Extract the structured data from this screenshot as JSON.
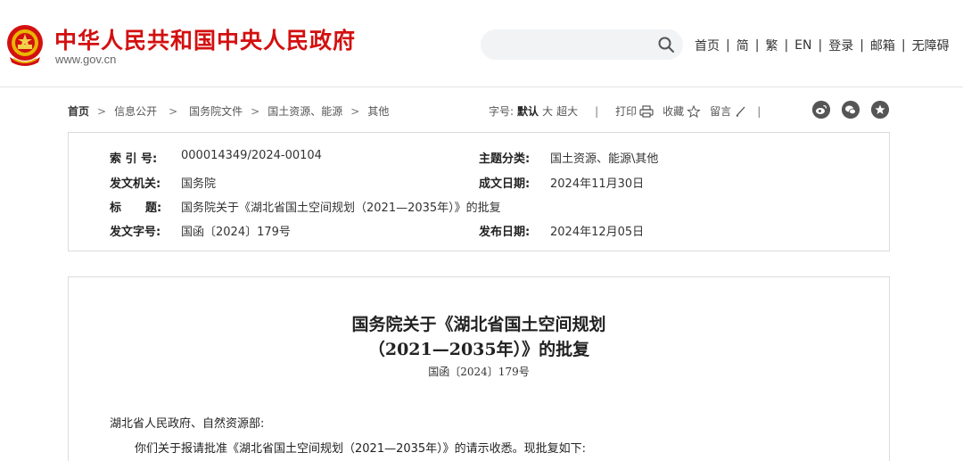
{
  "header": {
    "site_title": "中华人民共和国中央人民政府",
    "site_url": "www.gov.cn",
    "search_placeholder": "",
    "links": [
      "首页",
      "简",
      "繁",
      "EN",
      "登录",
      "邮箱",
      "无障碍"
    ],
    "separator": "|"
  },
  "breadcrumb": {
    "items": [
      "首页",
      "信息公开",
      "国务院文件",
      "国土资源、能源",
      "其他"
    ],
    "arrow": ">"
  },
  "tools": {
    "font_size_label": "字号:",
    "font_default": "默认",
    "font_large": "大",
    "font_xlarge": "超大",
    "separator": "|",
    "print": "打印",
    "favorite": "收藏",
    "comment": "留言"
  },
  "info": {
    "index_label": "索 引 号:",
    "index_value": "000014349/2024-00104",
    "topic_label": "主题分类:",
    "topic_value": "国土资源、能源\\其他",
    "issuer_label": "发文机关:",
    "issuer_value": "国务院",
    "date_written_label": "成文日期:",
    "date_written_value": "2024年11月30日",
    "title_label_a": "标",
    "title_label_b": "题:",
    "title_value": "国务院关于《湖北省国土空间规划（2021—2035年）》的批复",
    "docno_label": "发文字号:",
    "docno_value": "国函〔2024〕179号",
    "date_published_label": "发布日期:",
    "date_published_value": "2024年12月05日"
  },
  "document": {
    "title_line1": "国务院关于《湖北省国土空间规划",
    "title_line2": "（2021—2035年）》的批复",
    "number": "国函〔2024〕179号",
    "salutation": "湖北省人民政府、自然资源部:",
    "para1": "你们关于报请批准《湖北省国土空间规划（2021—2035年）》的请示收悉。现批复如下:"
  },
  "colors": {
    "brand_red": "#d31010",
    "search_bg": "#f1f3f4"
  }
}
